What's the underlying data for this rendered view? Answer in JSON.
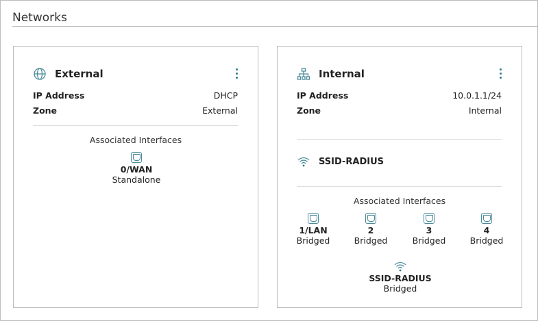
{
  "page": {
    "title": "Networks"
  },
  "networks": [
    {
      "name": "External",
      "icon": "globe-icon",
      "ip_label": "IP Address",
      "ip": "DHCP",
      "zone_label": "Zone",
      "zone": "External",
      "assoc_label": "Associated Interfaces",
      "interfaces": [
        {
          "name": "0/WAN",
          "status": "Standalone"
        }
      ]
    },
    {
      "name": "Internal",
      "icon": "network-tree-icon",
      "ip_label": "IP Address",
      "ip": "10.0.1.1/24",
      "zone_label": "Zone",
      "zone": "Internal",
      "ssid": "SSID-RADIUS",
      "assoc_label": "Associated Interfaces",
      "interfaces": [
        {
          "name": "1/LAN",
          "status": "Bridged"
        },
        {
          "name": "2",
          "status": "Bridged"
        },
        {
          "name": "3",
          "status": "Bridged"
        },
        {
          "name": "4",
          "status": "Bridged"
        },
        {
          "name": "SSID-RADIUS",
          "status": "Bridged"
        }
      ]
    }
  ],
  "colors": {
    "accent": "#2d7a8c"
  }
}
